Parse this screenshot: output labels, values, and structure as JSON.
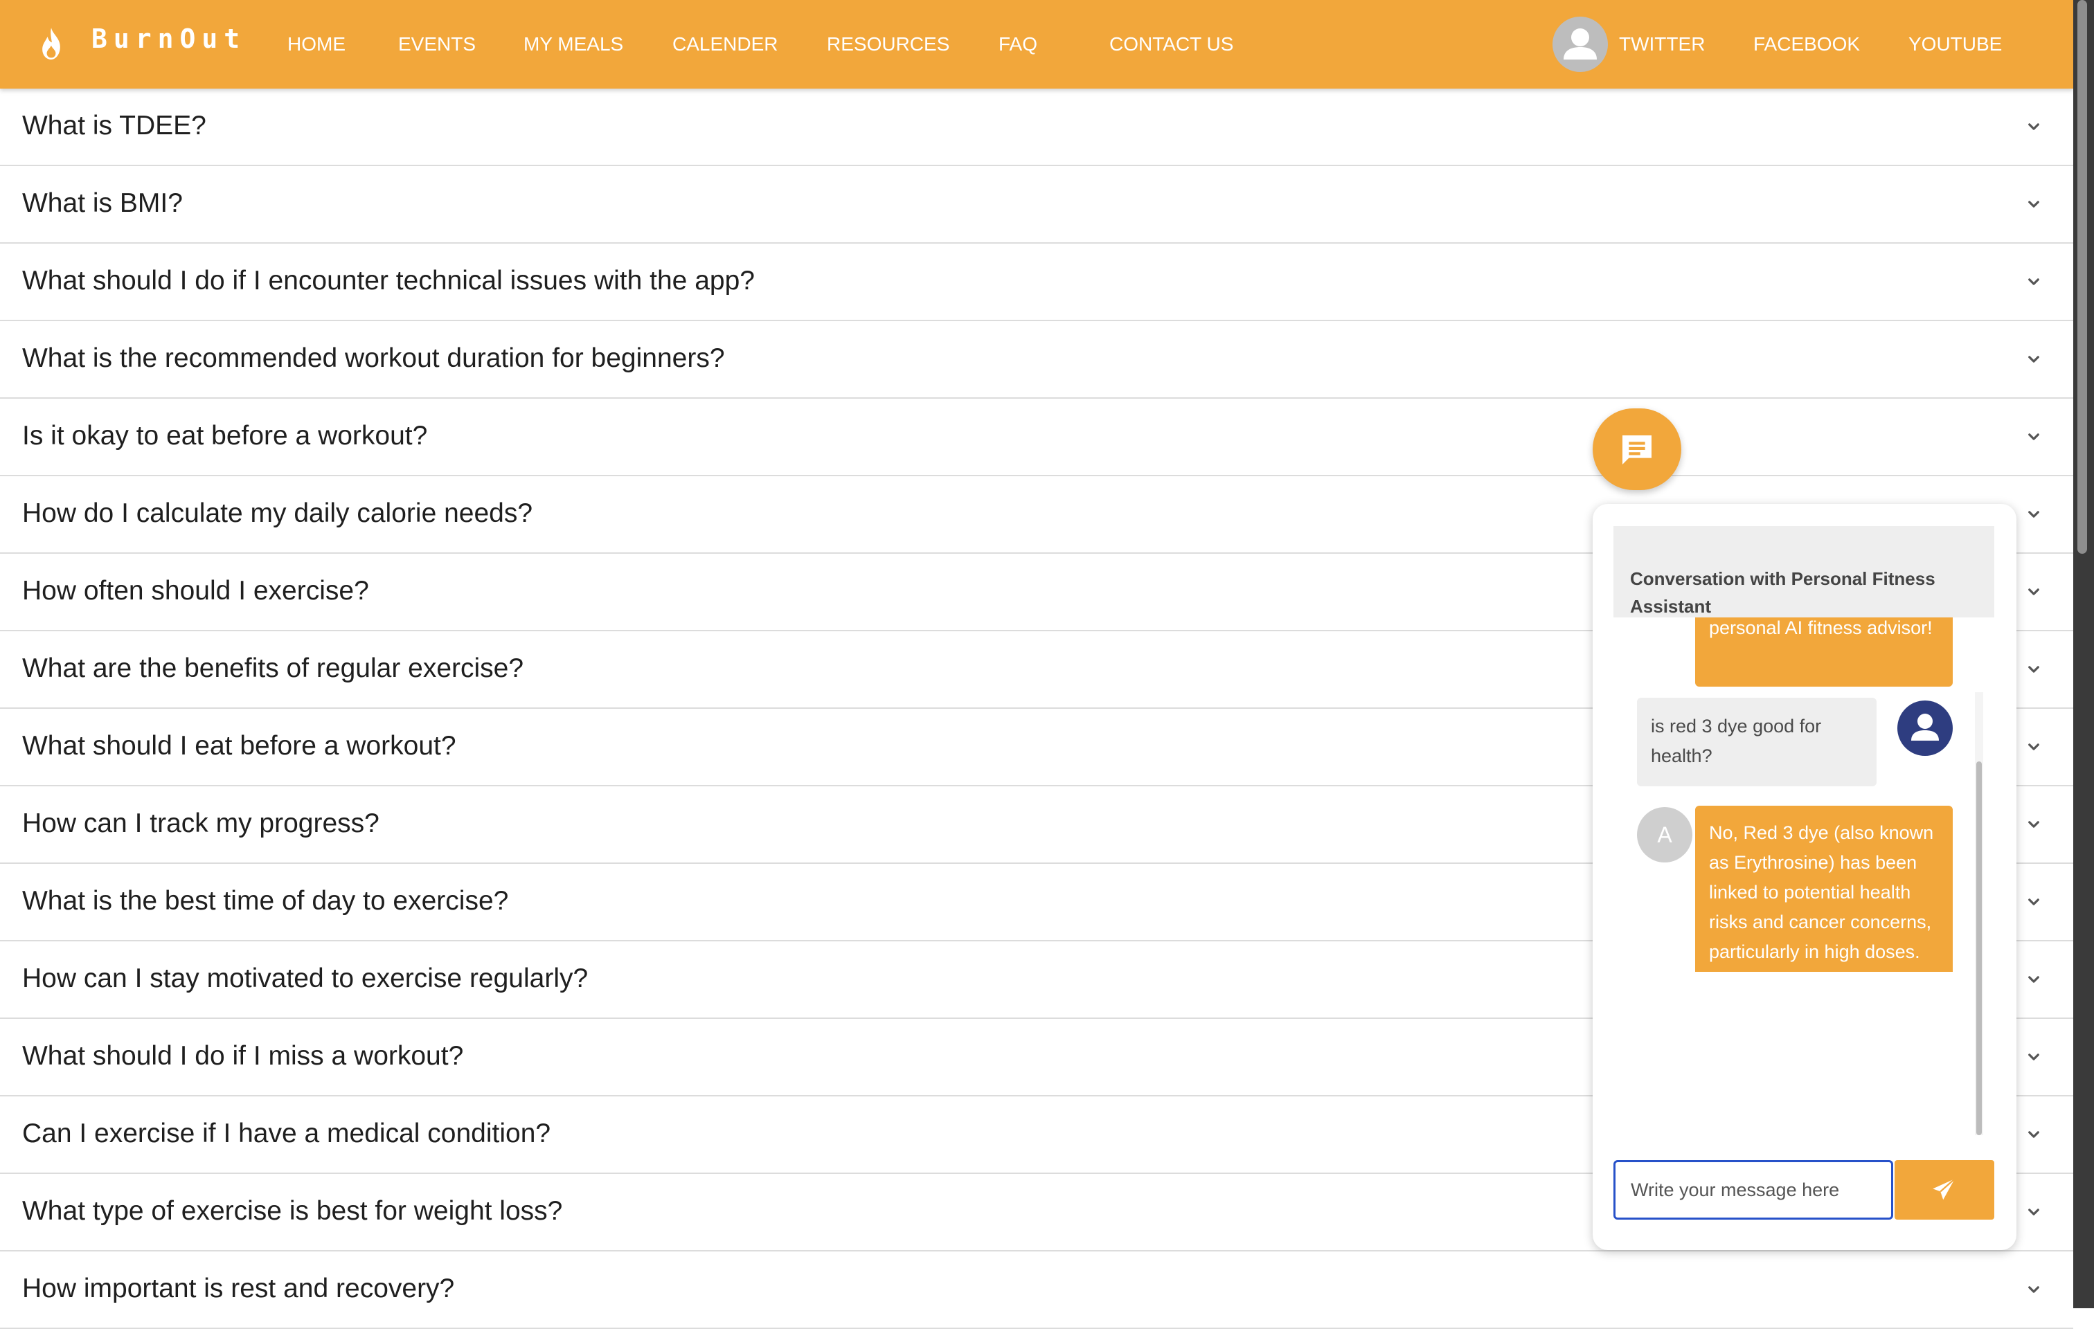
{
  "navbar": {
    "brand": "BurnOut",
    "links": [
      "HOME",
      "EVENTS",
      "MY MEALS",
      "CALENDER",
      "RESOURCES",
      "FAQ",
      "CONTACT US"
    ],
    "social": [
      "TWITTER",
      "FACEBOOK",
      "YOUTUBE"
    ],
    "icons": {
      "logo": "flame-icon",
      "avatar": "user-avatar-icon"
    },
    "color": "#f2a73b"
  },
  "faq": {
    "questions": [
      "What is TDEE?",
      "What is BMI?",
      "What should I do if I encounter technical issues with the app?",
      "What is the recommended workout duration for beginners?",
      "Is it okay to eat before a workout?",
      "How do I calculate my daily calorie needs?",
      "How often should I exercise?",
      "What are the benefits of regular exercise?",
      "What should I eat before a workout?",
      "How can I track my progress?",
      "What is the best time of day to exercise?",
      "How can I stay motivated to exercise regularly?",
      "What should I do if I miss a workout?",
      "Can I exercise if I have a medical condition?",
      "What type of exercise is best for weight loss?",
      "How important is rest and recovery?"
    ],
    "expand_icon": "chevron-down-icon"
  },
  "chat": {
    "header": "Conversation with Personal Fitness Assistant",
    "messages": [
      {
        "role": "bot",
        "text": "personal AI fitness advisor!"
      },
      {
        "role": "user",
        "text": "is red 3 dye good for health?"
      },
      {
        "role": "bot",
        "avatar_letter": "A",
        "text": "No, Red 3 dye (also known as Erythrosine) has been linked to potential health risks and cancer concerns, particularly in high doses. It's often banned or restricted in many countries due to these concerns."
      }
    ],
    "input_placeholder": "Write your message here",
    "icons": {
      "fab": "chat-icon",
      "send": "send-icon"
    }
  }
}
